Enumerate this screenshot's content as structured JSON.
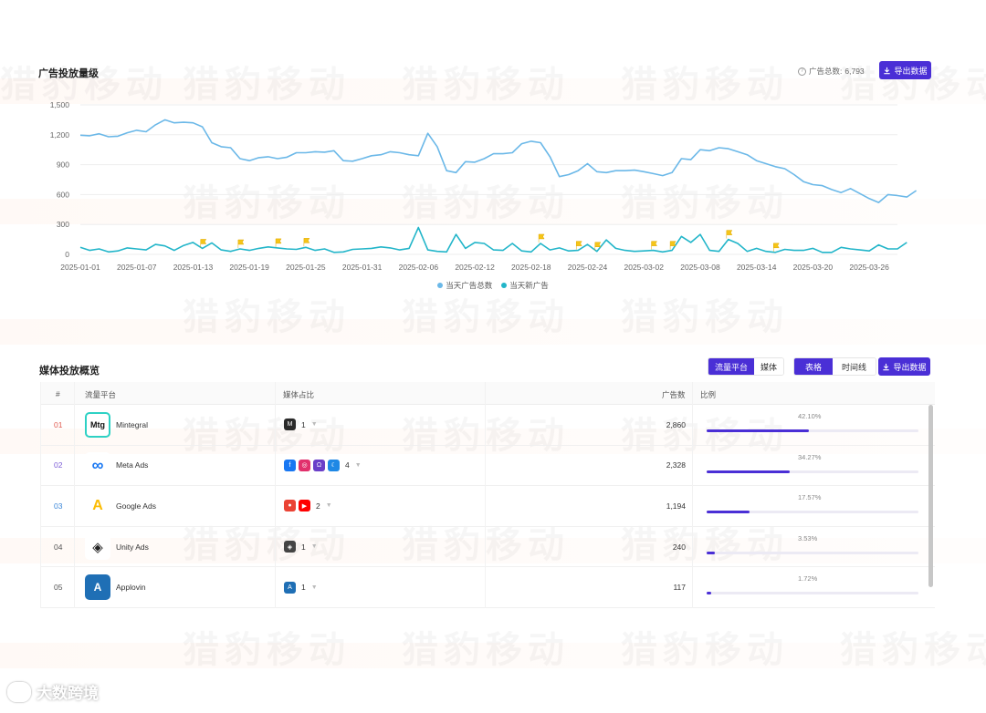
{
  "watermark": {
    "text": "猎豹移动"
  },
  "chart_section": {
    "title": "广告投放量级",
    "total_label": "广告总数:",
    "total_value": "6,793",
    "export_label": "导出数据"
  },
  "chart_data": {
    "type": "line",
    "x": [
      "2025-01-01",
      "2025-01-02",
      "2025-01-03",
      "2025-01-04",
      "2025-01-05",
      "2025-01-06",
      "2025-01-07",
      "2025-01-08",
      "2025-01-09",
      "2025-01-10",
      "2025-01-11",
      "2025-01-12",
      "2025-01-13",
      "2025-01-14",
      "2025-01-15",
      "2025-01-16",
      "2025-01-17",
      "2025-01-18",
      "2025-01-19",
      "2025-01-20",
      "2025-01-21",
      "2025-01-22",
      "2025-01-23",
      "2025-01-24",
      "2025-01-25",
      "2025-01-26",
      "2025-01-27",
      "2025-01-28",
      "2025-01-29",
      "2025-01-30",
      "2025-01-31",
      "2025-02-01",
      "2025-02-02",
      "2025-02-03",
      "2025-02-04",
      "2025-02-05",
      "2025-02-06",
      "2025-02-07",
      "2025-02-08",
      "2025-02-09",
      "2025-02-10",
      "2025-02-11",
      "2025-02-12",
      "2025-02-13",
      "2025-02-14",
      "2025-02-15",
      "2025-02-16",
      "2025-02-17",
      "2025-02-18",
      "2025-02-19",
      "2025-02-20",
      "2025-02-21",
      "2025-02-22",
      "2025-02-23",
      "2025-02-24",
      "2025-02-25",
      "2025-02-26",
      "2025-02-27",
      "2025-02-28",
      "2025-03-01",
      "2025-03-02",
      "2025-03-03",
      "2025-03-04",
      "2025-03-05",
      "2025-03-06",
      "2025-03-07",
      "2025-03-08",
      "2025-03-09",
      "2025-03-10",
      "2025-03-11",
      "2025-03-12",
      "2025-03-13",
      "2025-03-14",
      "2025-03-15",
      "2025-03-16",
      "2025-03-17",
      "2025-03-18",
      "2025-03-19",
      "2025-03-20",
      "2025-03-21",
      "2025-03-22",
      "2025-03-23",
      "2025-03-24",
      "2025-03-25",
      "2025-03-26",
      "2025-03-27",
      "2025-03-28",
      "2025-03-29"
    ],
    "x_tick_labels": [
      "2025-01-01",
      "2025-01-07",
      "2025-01-13",
      "2025-01-19",
      "2025-01-25",
      "2025-01-31",
      "2025-02-06",
      "2025-02-12",
      "2025-02-18",
      "2025-02-24",
      "2025-03-02",
      "2025-03-08",
      "2025-03-14",
      "2025-03-20",
      "2025-03-26"
    ],
    "x_tick_step": 6,
    "ylim": [
      0,
      1500
    ],
    "y_ticks": [
      0,
      300,
      600,
      900,
      1200,
      1500
    ],
    "y_tick_labels": [
      "0",
      "300",
      "600",
      "900",
      "1,200",
      "1,500"
    ],
    "grid": true,
    "legend_position": "bottom-center",
    "series": [
      {
        "name": "当天广告总数",
        "color": "#6bb8e8",
        "values": [
          1195,
          1190,
          1210,
          1180,
          1185,
          1220,
          1245,
          1230,
          1300,
          1350,
          1320,
          1325,
          1320,
          1280,
          1120,
          1080,
          1070,
          960,
          940,
          970,
          980,
          960,
          975,
          1020,
          1020,
          1030,
          1025,
          1040,
          940,
          935,
          960,
          990,
          1000,
          1030,
          1020,
          1000,
          990,
          1215,
          1080,
          840,
          820,
          930,
          925,
          960,
          1010,
          1010,
          1020,
          1110,
          1135,
          1120,
          980,
          780,
          800,
          840,
          910,
          830,
          820,
          840,
          840,
          845,
          830,
          810,
          790,
          820,
          960,
          950,
          1050,
          1040,
          1070,
          1060,
          1030,
          1000,
          940,
          910,
          880,
          860,
          800,
          730,
          700,
          690,
          650,
          620,
          660,
          610,
          560,
          520,
          600,
          590,
          575,
          640
        ]
      },
      {
        "name": "当天新广告",
        "color": "#22b5c9",
        "values": [
          70,
          40,
          55,
          25,
          35,
          65,
          55,
          45,
          100,
          85,
          40,
          90,
          120,
          60,
          115,
          45,
          30,
          55,
          40,
          60,
          75,
          65,
          55,
          50,
          70,
          40,
          55,
          20,
          25,
          50,
          55,
          60,
          75,
          65,
          45,
          60,
          270,
          45,
          30,
          25,
          200,
          60,
          120,
          110,
          45,
          40,
          110,
          35,
          25,
          110,
          45,
          65,
          35,
          40,
          100,
          30,
          145,
          60,
          40,
          30,
          35,
          40,
          25,
          40,
          180,
          120,
          200,
          40,
          30,
          150,
          110,
          30,
          60,
          30,
          20,
          50,
          40,
          40,
          60,
          20,
          20,
          70,
          55,
          45,
          35,
          95,
          55,
          55,
          120
        ]
      }
    ],
    "flag_dates": [
      "2025-01-14",
      "2025-01-18",
      "2025-01-22",
      "2025-01-25",
      "2025-02-19",
      "2025-02-23",
      "2025-02-25",
      "2025-03-03",
      "2025-03-05",
      "2025-03-11",
      "2025-03-16"
    ],
    "flag_color": "#f5c518"
  },
  "media_section": {
    "title": "媒体投放概览",
    "toggle1": [
      "流量平台",
      "媒体"
    ],
    "toggle2": [
      "表格",
      "时间线"
    ],
    "export_label": "导出数据",
    "headers": {
      "index": "#",
      "platform": "流量平台",
      "media_share": "媒体占比",
      "ads": "广告数",
      "ratio": "比例"
    },
    "rows": [
      {
        "index": "01",
        "index_color": "#e05a4f",
        "name": "Mintegral",
        "logo": "Mtg",
        "media_count": "1",
        "ads": "2,860",
        "pct": "42.10%",
        "share": 0.421
      },
      {
        "index": "02",
        "index_color": "#7c5cd6",
        "name": "Meta Ads",
        "logo": "∞",
        "media_count": "4",
        "ads": "2,328",
        "pct": "34.27%",
        "share": 0.3427
      },
      {
        "index": "03",
        "index_color": "#3a86d8",
        "name": "Google Ads",
        "logo": "A",
        "media_count": "2",
        "ads": "1,194",
        "pct": "17.57%",
        "share": 0.1757
      },
      {
        "index": "04",
        "index_color": "#555555",
        "name": "Unity Ads",
        "logo": "◈",
        "media_count": "1",
        "ads": "240",
        "pct": "3.53%",
        "share": 0.0353
      },
      {
        "index": "05",
        "index_color": "#555555",
        "name": "Applovin",
        "logo": "A",
        "media_count": "1",
        "ads": "117",
        "pct": "1.72%",
        "share": 0.0172
      }
    ]
  },
  "footer": {
    "brand": "大数跨境"
  },
  "colors": {
    "accent": "#4a2fd6"
  }
}
